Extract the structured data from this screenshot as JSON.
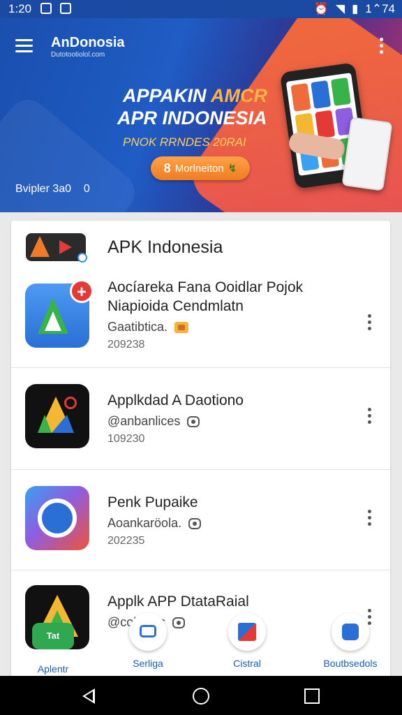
{
  "status_bar": {
    "time": "1:20",
    "right_text": "1⌃74",
    "icons": [
      "gallery-icon",
      "image-icon",
      "alarm-icon",
      "wifi-icon",
      "signal-icon",
      "battery-icon"
    ]
  },
  "header": {
    "app_name": "AnDonosia",
    "app_subtitle": "Dutotootiolol.com",
    "menu_icon": "hamburger-icon",
    "more_icon": "more-vert-icon"
  },
  "hero": {
    "title_line1_a": "APPAKIN ",
    "title_line1_b": "AMCR",
    "title_line2": "APR INDONESIA",
    "title_line3": "PNOK RRNDES 20RAI",
    "button_lead": "8",
    "button_label": "Morlneiton",
    "button_tail": "↯",
    "counter_label": "Bvipler 3a0",
    "counter_value": "0"
  },
  "list": {
    "title": "APK Indonesia",
    "items": [
      {
        "title_line1": "Aocíareka Fana Ooidlar Pojok",
        "title_line2": "Niapioida Cendmlatn",
        "subtitle": "Gaatibtica.",
        "badge": "gold-badge-icon",
        "meta": "209238"
      },
      {
        "title_line1": "Applkdad A Daotiono",
        "title_line2": "",
        "subtitle": "@anbanlices",
        "badge": "camera-badge-icon",
        "meta": "109230"
      },
      {
        "title_line1": "Penk Pupaike",
        "title_line2": "",
        "subtitle": "Aoankaröola.",
        "badge": "camera-badge-icon",
        "meta": "202235"
      },
      {
        "title_line1": "Applk APP DtataRaial",
        "title_line2": "",
        "subtitle": "@colnikes",
        "badge": "camera-badge-icon",
        "meta": ""
      }
    ]
  },
  "bottom_nav": [
    {
      "label": "Aplentr",
      "badge_text": "Tat"
    },
    {
      "label": "Serliga"
    },
    {
      "label": "Cistral"
    },
    {
      "label": "Boutbsedols"
    }
  ],
  "colors": {
    "primary_blue": "#1b4aa3",
    "accent_orange": "#f07c22",
    "link_blue": "#1a5cc8"
  }
}
